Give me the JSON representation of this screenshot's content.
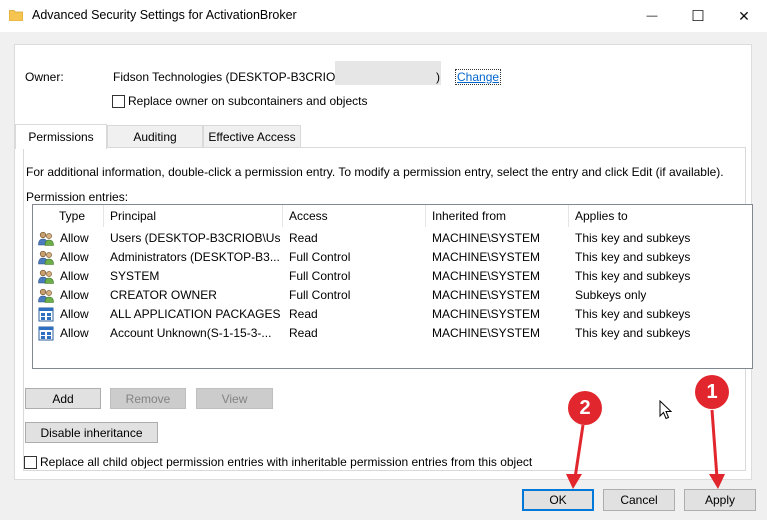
{
  "window": {
    "title": "Advanced Security Settings for ActivationBroker",
    "minimize_glyph": "—",
    "maximize_glyph": "☐",
    "close_glyph": "✕"
  },
  "owner": {
    "label": "Owner:",
    "value": "Fidson Technologies (DESKTOP-B3CRIOE",
    "value_end": ")",
    "change_link": "Change",
    "replace_checkbox_label": "Replace owner on subcontainers and objects"
  },
  "tabs": [
    {
      "label": "Permissions",
      "active": true
    },
    {
      "label": "Auditing",
      "active": false
    },
    {
      "label": "Effective Access",
      "active": false
    }
  ],
  "permissions": {
    "info_text": "For additional information, double-click a permission entry. To modify a permission entry, select the entry and click Edit (if available).",
    "entries_label": "Permission entries:",
    "columns": [
      "Type",
      "Principal",
      "Access",
      "Inherited from",
      "Applies to"
    ],
    "rows": [
      {
        "icon": "users-icon",
        "type": "Allow",
        "principal": "Users (DESKTOP-B3CRIOB\\Us...",
        "access": "Read",
        "inherited": "MACHINE\\SYSTEM",
        "applies": "This key and subkeys"
      },
      {
        "icon": "users-icon",
        "type": "Allow",
        "principal": "Administrators (DESKTOP-B3...",
        "access": "Full Control",
        "inherited": "MACHINE\\SYSTEM",
        "applies": "This key and subkeys"
      },
      {
        "icon": "users-icon",
        "type": "Allow",
        "principal": "SYSTEM",
        "access": "Full Control",
        "inherited": "MACHINE\\SYSTEM",
        "applies": "This key and subkeys"
      },
      {
        "icon": "users-icon",
        "type": "Allow",
        "principal": "CREATOR OWNER",
        "access": "Full Control",
        "inherited": "MACHINE\\SYSTEM",
        "applies": "Subkeys only"
      },
      {
        "icon": "package-icon",
        "type": "Allow",
        "principal": "ALL APPLICATION PACKAGES",
        "access": "Read",
        "inherited": "MACHINE\\SYSTEM",
        "applies": "This key and subkeys"
      },
      {
        "icon": "package-icon",
        "type": "Allow",
        "principal": "Account Unknown(S-1-15-3-...",
        "access": "Read",
        "inherited": "MACHINE\\SYSTEM",
        "applies": "This key and subkeys"
      }
    ],
    "add_button": "Add",
    "remove_button": "Remove",
    "view_button": "View",
    "disable_inheritance_button": "Disable inheritance",
    "replace_child_checkbox_label": "Replace all child object permission entries with inheritable permission entries from this object"
  },
  "footer": {
    "ok_button": "OK",
    "cancel_button": "Cancel",
    "apply_button": "Apply"
  },
  "annotations": {
    "badge_apply": "1",
    "badge_ok": "2",
    "color": "#e1262d"
  }
}
